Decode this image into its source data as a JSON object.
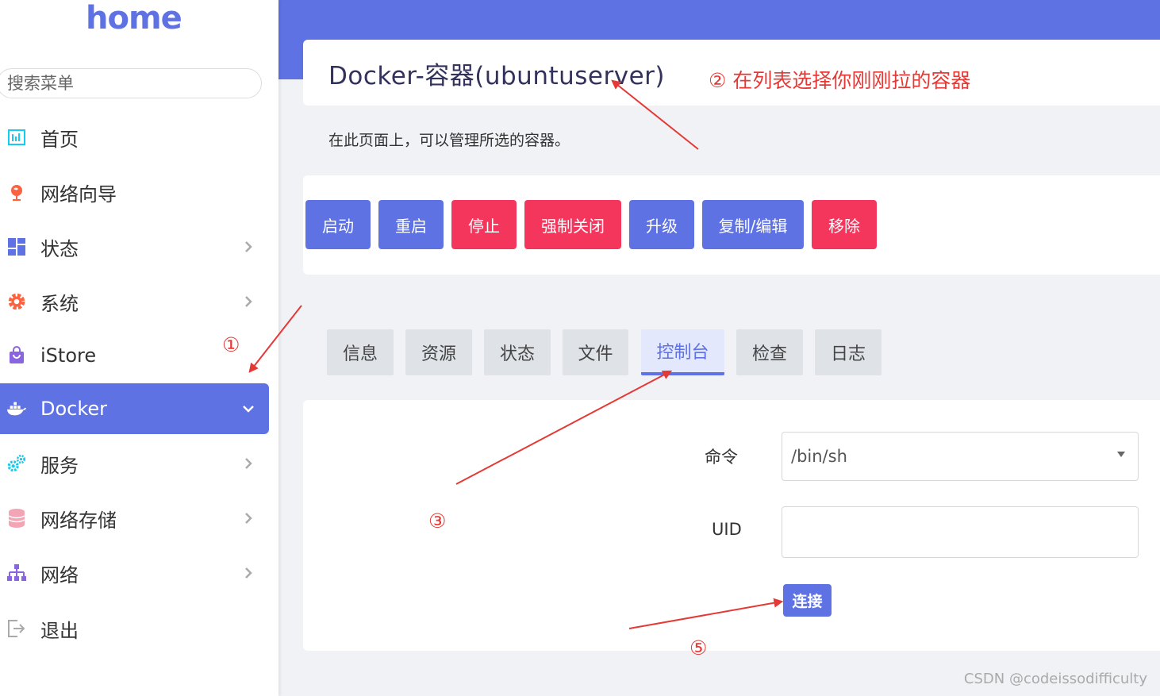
{
  "sidebar": {
    "logo": "home",
    "search_placeholder": "搜索菜单",
    "items": [
      {
        "label": "首页",
        "icon": "dashboard-icon"
      },
      {
        "label": "网络向导",
        "icon": "globe-icon"
      },
      {
        "label": "状态",
        "icon": "grid-icon"
      },
      {
        "label": "系统",
        "icon": "gear-icon"
      },
      {
        "label": "iStore",
        "icon": "bag-icon"
      },
      {
        "label": "Docker",
        "icon": "docker-icon",
        "active": true
      },
      {
        "label": "服务",
        "icon": "cogs-icon"
      },
      {
        "label": "网络存储",
        "icon": "database-icon"
      },
      {
        "label": "网络",
        "icon": "sitemap-icon"
      },
      {
        "label": "退出",
        "icon": "logout-icon"
      }
    ]
  },
  "main": {
    "title": "Docker-容器(ubuntuserver)",
    "description": "在此页面上，可以管理所选的容器。",
    "actions": [
      "启动",
      "重启",
      "停止",
      "强制关闭",
      "升级",
      "复制/编辑",
      "移除"
    ],
    "tabs": [
      "信息",
      "资源",
      "状态",
      "文件",
      "控制台",
      "检查",
      "日志"
    ],
    "active_tab": "控制台",
    "form": {
      "command_label": "命令",
      "command_value": "/bin/sh",
      "uid_label": "UID",
      "uid_value": "",
      "connect_label": "连接"
    }
  },
  "annotations": {
    "a1": "①",
    "a2": "② 在列表选择你刚刚拉的容器",
    "a3": "③",
    "a5": "⑤"
  },
  "watermark": "CSDN @codeissodifficulty",
  "colors": {
    "accent": "#5e72e4",
    "danger": "#f5365c",
    "annotation": "#e53935"
  }
}
